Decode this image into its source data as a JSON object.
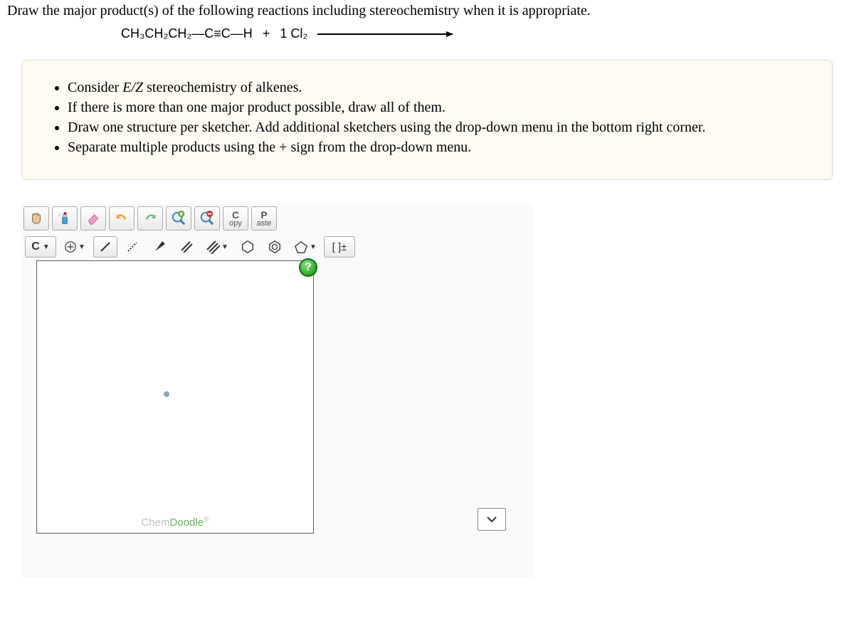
{
  "question": "Draw the major product(s) of the following reactions including stereochemistry when it is appropriate.",
  "reaction": {
    "reagent1": "CH₃CH₂CH₂—C≡C—H",
    "plus": "+",
    "reagent2": "1 Cl₂"
  },
  "instructions": [
    "Consider E/Z stereochemistry of alkenes.",
    "If there is more than one major product possible, draw all of them.",
    "Draw one structure per sketcher. Add additional sketchers using the drop-down menu in the bottom right corner.",
    "Separate multiple products using the + sign from the drop-down menu."
  ],
  "toolbar": {
    "copy_top": "C",
    "copy_bottom": "opy",
    "paste_top": "P",
    "paste_bottom": "aste",
    "element_label": "C",
    "brackets_label": "[ ]±",
    "help": "?",
    "watermark_chem": "Chem",
    "watermark_doodle": "Doodle",
    "watermark_r": "®"
  }
}
